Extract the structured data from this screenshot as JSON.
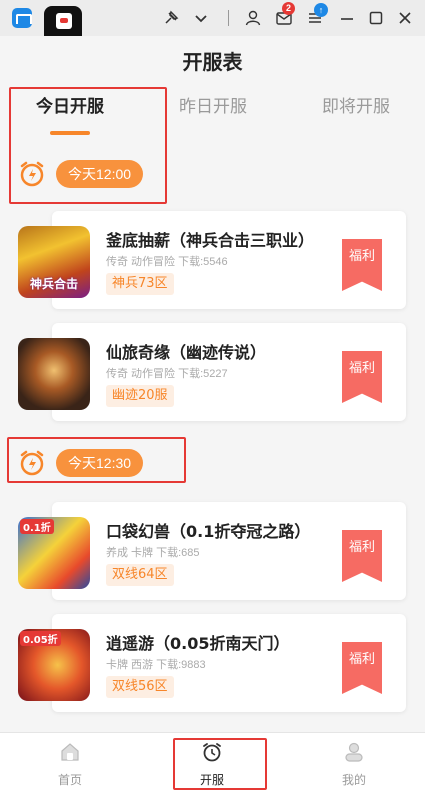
{
  "window": {
    "mail_badge": "2",
    "menu_badge": "↑"
  },
  "header": {
    "title": "开服表"
  },
  "tabs": [
    {
      "label": "今日开服",
      "active": true
    },
    {
      "label": "昨日开服",
      "active": false
    },
    {
      "label": "即将开服",
      "active": false
    }
  ],
  "groups": [
    {
      "time": "今天12:00",
      "games": [
        {
          "name": "釜底抽薪（神兵合击三职业）",
          "meta": "传奇 动作冒险 下载:5546",
          "server": "神兵73区",
          "tag": "福利",
          "thumb_text": "神兵合击"
        },
        {
          "name": "仙旅奇缘（幽迹传说）",
          "meta": "传奇 动作冒险 下载:5227",
          "server": "幽迹20服",
          "tag": "福利",
          "thumb_text": ""
        }
      ]
    },
    {
      "time": "今天12:30",
      "games": [
        {
          "name": "口袋幻兽（0.1折夺冠之路）",
          "meta": "养成 卡牌 下载:685",
          "server": "双线64区",
          "tag": "福利",
          "thumb_text": "0.1折"
        },
        {
          "name": "逍遥游（0.05折南天门）",
          "meta": "卡牌 西游 下载:9883",
          "server": "双线56区",
          "tag": "福利",
          "thumb_text": "0.05折"
        }
      ]
    }
  ],
  "bottom_nav": [
    {
      "label": "首页",
      "icon": "home-icon",
      "active": false
    },
    {
      "label": "开服",
      "icon": "alarm-clock-icon",
      "active": true
    },
    {
      "label": "我的",
      "icon": "user-icon",
      "active": false
    }
  ],
  "colors": {
    "accent": "#f7862a",
    "tag_red": "#f66b63",
    "highlight": "#e53935"
  }
}
